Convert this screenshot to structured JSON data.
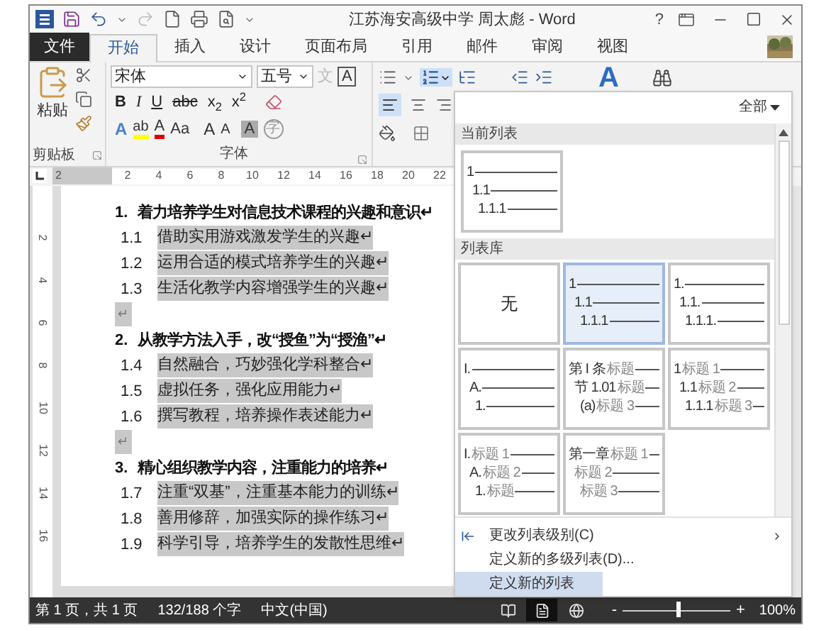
{
  "window": {
    "title": "江苏海安高级中学 周太彪 - Word",
    "help": "?"
  },
  "tabs": [
    {
      "label": "文件",
      "kind": "file",
      "selected": false
    },
    {
      "label": "开始",
      "kind": "tab",
      "selected": true
    },
    {
      "label": "插入",
      "kind": "tab",
      "selected": false
    },
    {
      "label": "设计",
      "kind": "tab",
      "selected": false
    },
    {
      "label": "页面布局",
      "kind": "tab",
      "selected": false
    },
    {
      "label": "引用",
      "kind": "tab",
      "selected": false
    },
    {
      "label": "邮件",
      "kind": "tab",
      "selected": false
    },
    {
      "label": "审阅",
      "kind": "tab",
      "selected": false
    },
    {
      "label": "视图",
      "kind": "tab",
      "selected": false
    }
  ],
  "ribbon": {
    "clipboard": {
      "paste": "粘贴",
      "label": "剪贴板"
    },
    "font": {
      "name": "宋体",
      "size": "五号",
      "phonetic": "文",
      "border": "A",
      "row2": [
        "B",
        "I",
        "U",
        "abc",
        "x$_{2}$",
        "x$^{2}$"
      ],
      "effects": "A",
      "highlight": "ab",
      "font_color": "A",
      "case": "Aa",
      "grow": "A",
      "shrink": "A",
      "shading": "A",
      "enclose": "字",
      "label": "字体"
    },
    "styles": "A"
  },
  "ruler": {
    "horizontal": [
      "2",
      "2",
      "4",
      "6",
      "8",
      "10",
      "12",
      "14",
      "16",
      "18",
      "20",
      "22"
    ],
    "vertical": [
      "2",
      "4",
      "6",
      "8",
      "10",
      "12",
      "14",
      "16"
    ]
  },
  "document": {
    "paragraphs": [
      {
        "kind": "heading",
        "number": "1.",
        "text": "着力培养学生对信息技术课程的兴趣和意识↵",
        "highlighted": false
      },
      {
        "kind": "item",
        "number": "1.1",
        "text": "借助实用游戏激发学生的兴趣↵",
        "highlighted": true
      },
      {
        "kind": "item",
        "number": "1.2",
        "text": "运用合适的模式培养学生的兴趣↵",
        "highlighted": true
      },
      {
        "kind": "item",
        "number": "1.3",
        "text": "生活化教学内容增强学生的兴趣↵",
        "highlighted": true
      },
      {
        "kind": "empty",
        "text": "↵",
        "highlighted": true
      },
      {
        "kind": "heading",
        "number": "2.",
        "text": "从教学方法入手，改“授鱼”为“授渔”↵",
        "highlighted": false
      },
      {
        "kind": "item",
        "number": "1.4",
        "text": "自然融合，巧妙强化学科整合↵",
        "highlighted": true
      },
      {
        "kind": "item",
        "number": "1.5",
        "text": "虚拟任务，强化应用能力↵",
        "highlighted": true
      },
      {
        "kind": "item",
        "number": "1.6",
        "text": "撰写教程，培养操作表述能力↵",
        "highlighted": true
      },
      {
        "kind": "empty",
        "text": "↵",
        "highlighted": true
      },
      {
        "kind": "heading",
        "number": "3.",
        "text": "精心组织教学内容，注重能力的培养↵",
        "highlighted": false
      },
      {
        "kind": "item",
        "number": "1.7",
        "text": "注重“双基”，注重基本能力的训练↵",
        "highlighted": true
      },
      {
        "kind": "item",
        "number": "1.8",
        "text": "善用修辞，加强实际的操作练习↵",
        "highlighted": true
      },
      {
        "kind": "item",
        "number": "1.9",
        "text": "科学引导，培养学生的发散性思维↵",
        "highlighted": true
      }
    ]
  },
  "list_panel": {
    "filter": "全部",
    "current_header": "当前列表",
    "current": [
      {
        "kind": "lines",
        "selected": false,
        "rows": [
          {
            "label": "1"
          },
          {
            "label": "1.1"
          },
          {
            "label": "1.1.1"
          }
        ]
      }
    ],
    "library_header": "列表库",
    "library": [
      {
        "kind": "none",
        "label": "无",
        "selected": false
      },
      {
        "kind": "lines",
        "selected": true,
        "rows": [
          {
            "label": "1"
          },
          {
            "label": "1.1"
          },
          {
            "label": "1.1.1"
          }
        ]
      },
      {
        "kind": "lines",
        "selected": false,
        "rows": [
          {
            "label": "1."
          },
          {
            "label": "1.1."
          },
          {
            "label": "1.1.1."
          }
        ]
      },
      {
        "kind": "lines",
        "selected": false,
        "rows": [
          {
            "label": "I."
          },
          {
            "label": "A."
          },
          {
            "label": "1."
          }
        ]
      },
      {
        "kind": "lines",
        "selected": false,
        "rows": [
          {
            "label": "第 I 条",
            "caption": "标题"
          },
          {
            "label": "节 1.01",
            "caption": "标题"
          },
          {
            "label": "(a)",
            "caption": "标题 3"
          }
        ]
      },
      {
        "kind": "lines",
        "selected": false,
        "rows": [
          {
            "label": "1",
            "caption": "标题 1"
          },
          {
            "label": "1.1",
            "caption": "标题 2"
          },
          {
            "label": "1.1.1",
            "caption": "标题 3"
          }
        ]
      },
      {
        "kind": "lines",
        "selected": false,
        "rows": [
          {
            "label": "I.",
            "caption": "标题 1"
          },
          {
            "label": "A.",
            "caption": "标题 2"
          },
          {
            "label": "1.",
            "caption": "标题"
          }
        ]
      },
      {
        "kind": "lines",
        "selected": false,
        "rows": [
          {
            "label": "第一章",
            "caption": "标题 1"
          },
          {
            "caption": "标题 2"
          },
          {
            "caption": "标题 3"
          }
        ]
      }
    ],
    "menu": [
      {
        "label": "更改列表级别(C)",
        "kind": "submenu",
        "hovered": false
      },
      {
        "label": "定义新的多级列表(D)...",
        "kind": "command",
        "hovered": false
      },
      {
        "label": "定义新的列表",
        "kind": "command",
        "hovered": true
      }
    ]
  },
  "status_bar": {
    "page": "第 1 页，共 1 页",
    "words": "132/188 个字",
    "language": "中文(中国)",
    "views": [
      {
        "kind": "read",
        "selected": false
      },
      {
        "kind": "print",
        "selected": true
      },
      {
        "kind": "web",
        "selected": false
      }
    ],
    "zoom_out": "-",
    "zoom_in": "+",
    "zoom": "100%",
    "zoom_slider": {
      "level": 0.5
    }
  }
}
